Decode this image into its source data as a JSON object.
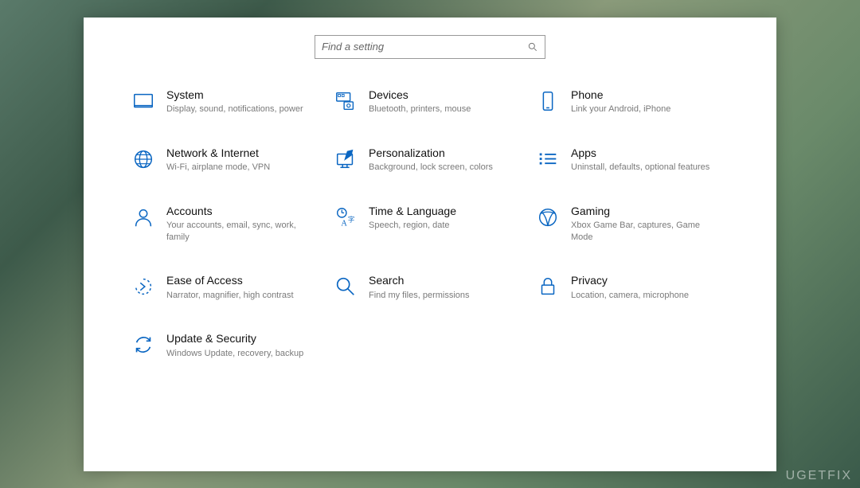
{
  "colors": {
    "icon": "#0a66c2",
    "subtext": "#7a7a7a"
  },
  "search": {
    "placeholder": "Find a setting"
  },
  "tiles": [
    {
      "id": "system",
      "title": "System",
      "sub": "Display, sound, notifications, power"
    },
    {
      "id": "devices",
      "title": "Devices",
      "sub": "Bluetooth, printers, mouse"
    },
    {
      "id": "phone",
      "title": "Phone",
      "sub": "Link your Android, iPhone"
    },
    {
      "id": "network",
      "title": "Network & Internet",
      "sub": "Wi-Fi, airplane mode, VPN"
    },
    {
      "id": "personalization",
      "title": "Personalization",
      "sub": "Background, lock screen, colors"
    },
    {
      "id": "apps",
      "title": "Apps",
      "sub": "Uninstall, defaults, optional features"
    },
    {
      "id": "accounts",
      "title": "Accounts",
      "sub": "Your accounts, email, sync, work, family"
    },
    {
      "id": "time",
      "title": "Time & Language",
      "sub": "Speech, region, date"
    },
    {
      "id": "gaming",
      "title": "Gaming",
      "sub": "Xbox Game Bar, captures, Game Mode"
    },
    {
      "id": "ease",
      "title": "Ease of Access",
      "sub": "Narrator, magnifier, high contrast"
    },
    {
      "id": "search",
      "title": "Search",
      "sub": "Find my files, permissions"
    },
    {
      "id": "privacy",
      "title": "Privacy",
      "sub": "Location, camera, microphone"
    },
    {
      "id": "update",
      "title": "Update & Security",
      "sub": "Windows Update, recovery, backup"
    }
  ],
  "watermark": "UGETFIX"
}
